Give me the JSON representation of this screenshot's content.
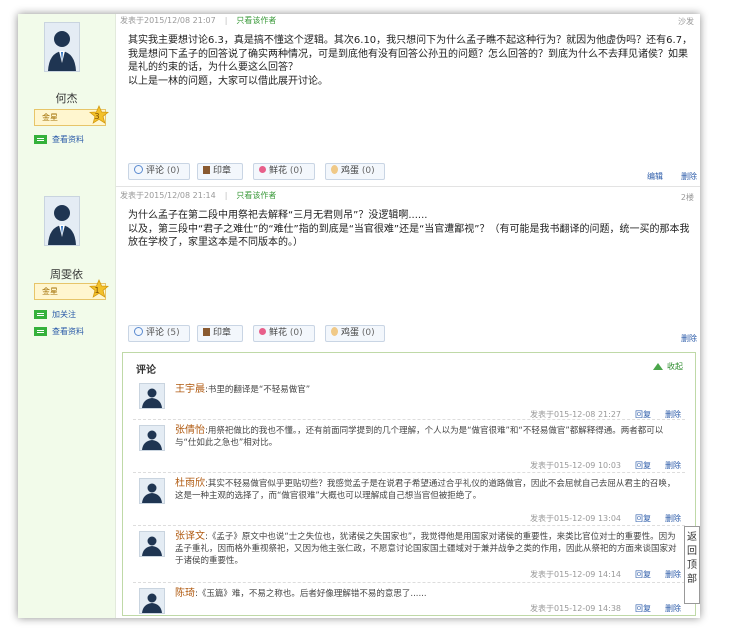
{
  "post1": {
    "user": {
      "name": "何杰",
      "level_label": "金星",
      "level_num": "3",
      "links": [
        {
          "label": "查看资料"
        }
      ]
    },
    "meta": {
      "time": "发表于2015/12/08 21:07",
      "only_author": "只看该作者"
    },
    "floor": "沙发",
    "body": [
      "其实我主要想讨论6.3，真是搞不懂这个逻辑。其次6.10，我只想问下为什么孟子瞧不起这种行为？就因为他虚伪吗？还有6.7，我是想问下孟子的回答说了确实两种情况，可是到底他有没有回答公孙丑的问题？怎么回答的？到底为什么不去拜见诸侯？如果是礼的约束的话，为什么要这么回答？",
      "以上是一林的问题，大家可以借此展开讨论。"
    ],
    "toolbar": [
      {
        "icon": "comment-icon",
        "label": "评论",
        "count": "(0)"
      },
      {
        "icon": "stamp-icon",
        "label": "印章",
        "count": ""
      },
      {
        "icon": "flower-icon",
        "label": "鲜花",
        "count": "(0)"
      },
      {
        "icon": "egg-icon",
        "label": "鸡蛋",
        "count": "(0)"
      }
    ],
    "actions": {
      "edit": "编辑",
      "delete": "删除"
    }
  },
  "post2": {
    "user": {
      "name": "周雯依",
      "level_label": "金星",
      "level_num": "1",
      "links": [
        {
          "label": "加关注"
        },
        {
          "label": "查看资料"
        }
      ]
    },
    "meta": {
      "time": "发表于2015/12/08 21:14",
      "only_author": "只看该作者"
    },
    "floor": "2楼",
    "body": [
      "为什么孟子在第二段中用祭祀去解释“三月无君则吊”？没逻辑啊......",
      "以及，第三段中“君子之难仕”的“难仕”指的到底是“当官很难”还是“当官遭鄙视”？（有可能是我书翻译的问题，统一买的那本我放在学校了，家里这本是不同版本的。）"
    ],
    "toolbar": [
      {
        "icon": "comment-icon",
        "label": "评论",
        "count": "(5)"
      },
      {
        "icon": "stamp-icon",
        "label": "印章",
        "count": ""
      },
      {
        "icon": "flower-icon",
        "label": "鲜花",
        "count": "(0)"
      },
      {
        "icon": "egg-icon",
        "label": "鸡蛋",
        "count": "(0)"
      }
    ],
    "actions": {
      "delete": "删除"
    }
  },
  "comments": {
    "title": "评论",
    "collapse": "收起",
    "reply": "回复",
    "delete": "删除",
    "items": [
      {
        "user": "王宇晨",
        "text": ":书里的翻译是“不轻易做官”",
        "time": "发表于015-12-08 21:27"
      },
      {
        "user": "张倩怡",
        "text": ":用祭祀做比的我也不懂。，还有前面同学提到的几个理解，个人以为是“做官很难”和“不轻易做官”都解释得通。两者都可以与“仕如此之急也”相对比。",
        "time": "发表于015-12-09 10:03"
      },
      {
        "user": "杜雨欣",
        "text": ":其实不轻易做官似乎更贴切些？我感觉孟子是在说君子希望通过合乎礼仪的道路做官，因此不会屈就自己去屈从君主的召唤，这是一种主观的选择了，而“做官很难”大概也可以理解成自己想当官但被拒绝了。",
        "time": "发表于015-12-09 13:04"
      },
      {
        "user": "张译文",
        "text": ":《孟子》原文中也说“士之失位也，犹诸侯之失国家也”，我觉得他是用国家对诸侯的重要性，来类比官位对士的重要性。因为孟子重礼，因而格外重视祭祀，又因为他主张仁政，不愿意讨论国家国土疆域对于兼并战争之类的作用，因此从祭祀的方面来谈国家对于诸侯的重要性。",
        "time": "发表于015-12-09 14:14"
      },
      {
        "user": "陈琦",
        "text": ":《玉篇》难，不易之称也。后者好像理解错不易的意思了......",
        "time": "发表于015-12-09 14:38"
      }
    ]
  },
  "back_to_top": "返回顶部"
}
